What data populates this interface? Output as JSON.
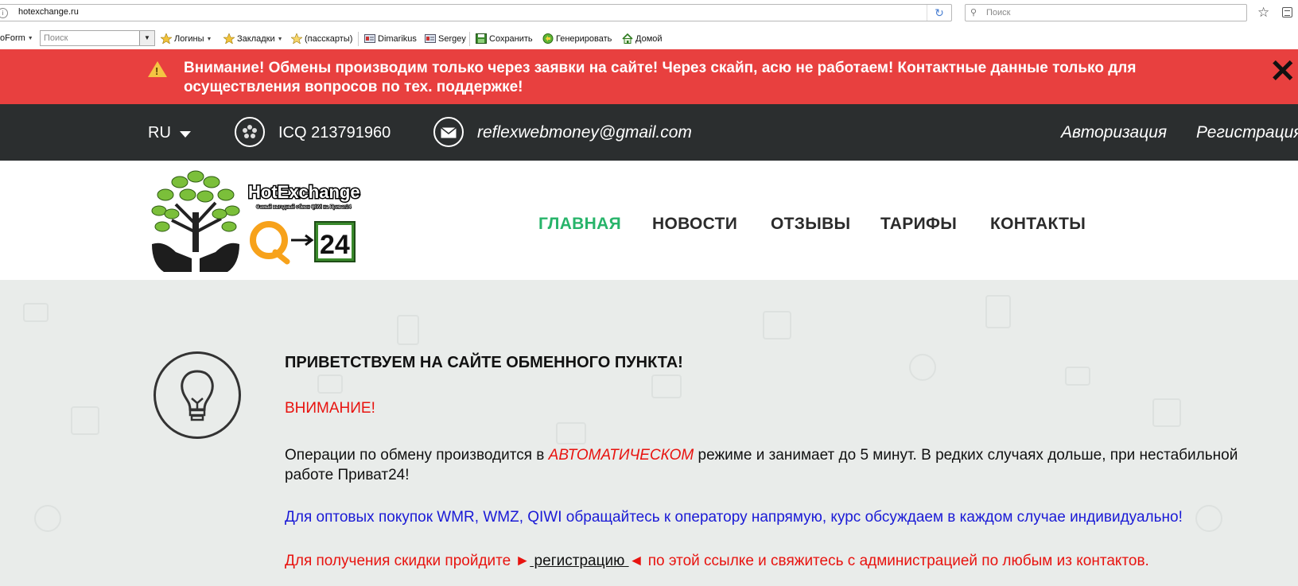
{
  "browser": {
    "url": "hotexchange.ru",
    "search_placeholder": "Поиск"
  },
  "bookmarks": {
    "form_label": "oForm",
    "search_placeholder": "Поиск",
    "items": {
      "logins": "Логины",
      "bookmarks": "Закладки",
      "passcards": "(пасскарты)",
      "dimarikus": "Dimarikus",
      "sergey": "Sergey",
      "save": "Сохранить",
      "generate": "Генерировать",
      "home": "Домой"
    }
  },
  "alert": {
    "text": "Внимание! Обмены производим только через заявки на сайте! Через скайп, асю не работаем! Контактные данные только для осуществления вопросов по тех. поддержке!",
    "close": "✕"
  },
  "topbar": {
    "lang": "RU",
    "icq": "ICQ 213791960",
    "email": "reflexwebmoney@gmail.com",
    "login": "Авторизация",
    "register": "Регистрация"
  },
  "logo": {
    "name": "HotExchange",
    "tagline": "Самый выгодный обмен QIWI на Приват24",
    "badge": "24"
  },
  "nav": {
    "home": "ГЛАВНАЯ",
    "news": "НОВОСТИ",
    "reviews": "ОТЗЫВЫ",
    "tariffs": "ТАРИФЫ",
    "contacts": "КОНТАКТЫ"
  },
  "content": {
    "title": "ПРИВЕТСТВУЕМ НА САЙТЕ ОБМЕННОГО ПУНКТА!",
    "warning": "ВНИМАНИЕ!",
    "p1_before": "Операции по обмену производится в ",
    "p1_auto": "АВТОМАТИЧЕСКОМ",
    "p1_after": " режиме и занимает до 5 минут. В редких случаях дольше, при нестабильной работе Приват24!",
    "p2": "Для оптовых покупок WMR, WMZ, QIWI обращайтесь к оператору напрямую, курс обсуждаем в каждом случае индивидуально!",
    "p3_before": "Для получения скидки пройдите ►",
    "p3_link": " регистрацию ",
    "p3_after": "◄ по этой ссылке и свяжитесь с администрацией по любым из контактов."
  },
  "colors": {
    "alert_bg": "#e8403f",
    "topbar_bg": "#2b2e2f",
    "nav_active": "#27b46a",
    "text_red": "#e8130f",
    "text_blue": "#1a1ad6"
  }
}
